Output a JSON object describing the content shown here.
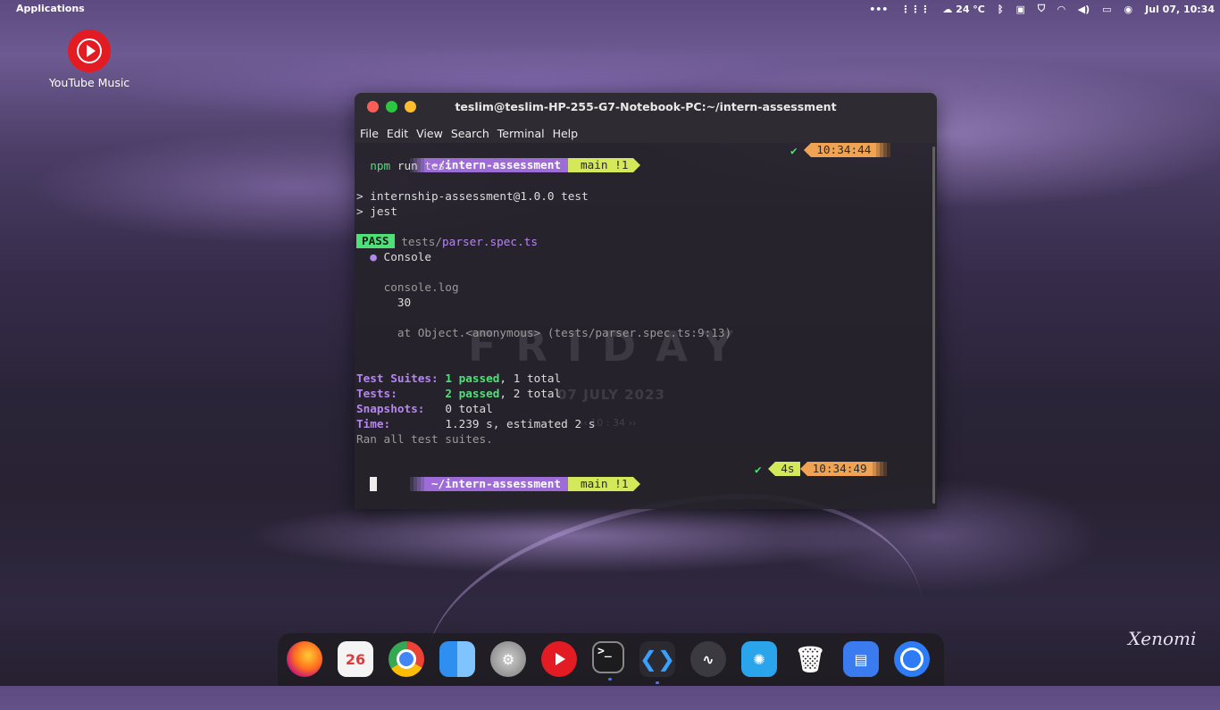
{
  "topbar": {
    "apps_label": "Applications",
    "weather": "24 °C",
    "datetime": "Jul 07, 10:34"
  },
  "desktop": {
    "icon_label": "YouTube Music"
  },
  "window": {
    "title": "teslim@teslim-HP-255-G7-Notebook-PC:~/intern-assessment",
    "menu": [
      "File",
      "Edit",
      "View",
      "Search",
      "Terminal",
      "Help"
    ]
  },
  "terminal": {
    "prompt1": {
      "path": "~/intern-assessment",
      "git": "main !1",
      "status": "✔",
      "time": "10:34:44"
    },
    "command_bin": "npm",
    "command_args": " run test",
    "out1": "> internship-assessment@1.0.0 test",
    "out2": "> jest",
    "pass_badge": "PASS",
    "test_dir": "tests/",
    "test_file": "parser.spec.ts",
    "console_bullet": "●",
    "console_label": " Console",
    "console_log": "console.log",
    "console_value": "30",
    "console_at": "at Object.<anonymous> (tests/parser.spec.ts:9:13)",
    "suites_label": "Test Suites: ",
    "suites_pass": "1 passed",
    "suites_total": ", 1 total",
    "tests_label": "Tests:       ",
    "tests_pass": "2 passed",
    "tests_total": ", 2 total",
    "snap_label": "Snapshots:   ",
    "snap_value": "0 total",
    "time_label": "Time:        ",
    "time_value": "1.239 s, estimated 2 s",
    "ran_all": "Ran all test suites.",
    "prompt2": {
      "path": "~/intern-assessment",
      "git": "main !1",
      "status": "✔",
      "duration": "4s",
      "time": "10:34:49"
    },
    "wallpaper_day": "FRIDAY",
    "wallpaper_date": "07 JULY 2023",
    "wallpaper_time": "‹‹ 10 : 34 ››"
  },
  "dock": {
    "calendar_day": "26",
    "terminal_glyph": ">_"
  },
  "signature": "Xenomi",
  "colors": {
    "accent_purple": "#9d6cd6",
    "git_yellow": "#d4e85a",
    "time_orange": "#f0a453",
    "pass_green": "#4ee178"
  }
}
